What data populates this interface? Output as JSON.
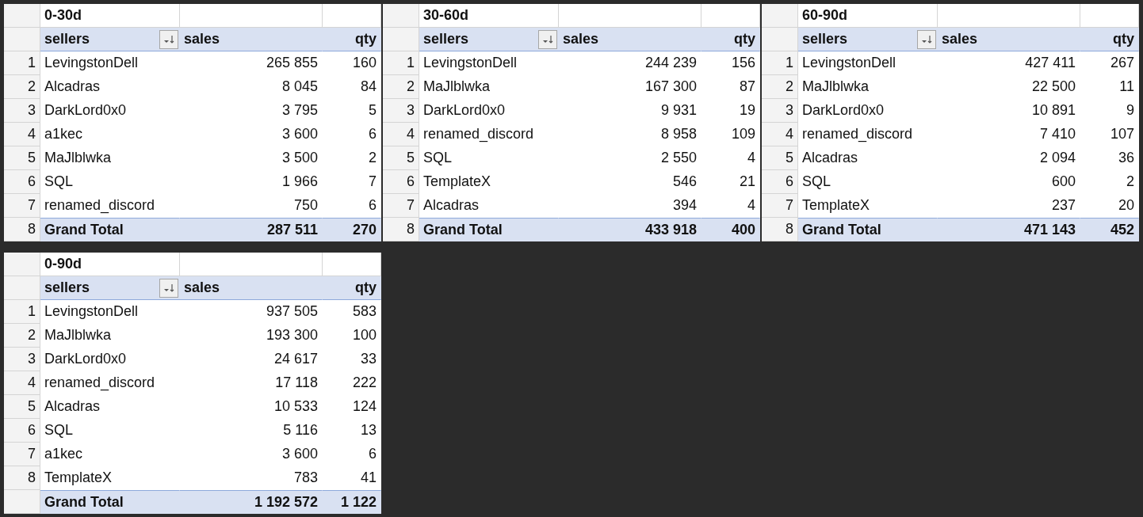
{
  "pivot_tables": [
    {
      "title": "0-30d",
      "columns": [
        "sellers",
        "sales",
        "qty"
      ],
      "rows": [
        {
          "number": "1",
          "seller": "LevingstonDell",
          "sales": "265 855",
          "qty": "160"
        },
        {
          "number": "2",
          "seller": "Alcadras",
          "sales": "8 045",
          "qty": "84"
        },
        {
          "number": "3",
          "seller": "DarkLord0x0",
          "sales": "3 795",
          "qty": "5"
        },
        {
          "number": "4",
          "seller": "a1kec",
          "sales": "3 600",
          "qty": "6"
        },
        {
          "number": "5",
          "seller": "MaJlblwka",
          "sales": "3 500",
          "qty": "2"
        },
        {
          "number": "6",
          "seller": "SQL",
          "sales": "1 966",
          "qty": "7"
        },
        {
          "number": "7",
          "seller": "renamed_discord",
          "sales": "750",
          "qty": "6"
        }
      ],
      "total": {
        "number": "8",
        "label": "Grand Total",
        "sales": "287 511",
        "qty": "270"
      }
    },
    {
      "title": "30-60d",
      "columns": [
        "sellers",
        "sales",
        "qty"
      ],
      "rows": [
        {
          "number": "1",
          "seller": "LevingstonDell",
          "sales": "244 239",
          "qty": "156"
        },
        {
          "number": "2",
          "seller": "MaJlblwka",
          "sales": "167 300",
          "qty": "87"
        },
        {
          "number": "3",
          "seller": "DarkLord0x0",
          "sales": "9 931",
          "qty": "19"
        },
        {
          "number": "4",
          "seller": "renamed_discord",
          "sales": "8 958",
          "qty": "109"
        },
        {
          "number": "5",
          "seller": "SQL",
          "sales": "2 550",
          "qty": "4"
        },
        {
          "number": "6",
          "seller": "TemplateX",
          "sales": "546",
          "qty": "21"
        },
        {
          "number": "7",
          "seller": "Alcadras",
          "sales": "394",
          "qty": "4"
        }
      ],
      "total": {
        "number": "8",
        "label": "Grand Total",
        "sales": "433 918",
        "qty": "400"
      }
    },
    {
      "title": "60-90d",
      "columns": [
        "sellers",
        "sales",
        "qty"
      ],
      "rows": [
        {
          "number": "1",
          "seller": "LevingstonDell",
          "sales": "427 411",
          "qty": "267"
        },
        {
          "number": "2",
          "seller": "MaJlblwka",
          "sales": "22 500",
          "qty": "11"
        },
        {
          "number": "3",
          "seller": "DarkLord0x0",
          "sales": "10 891",
          "qty": "9"
        },
        {
          "number": "4",
          "seller": "renamed_discord",
          "sales": "7 410",
          "qty": "107"
        },
        {
          "number": "5",
          "seller": "Alcadras",
          "sales": "2 094",
          "qty": "36"
        },
        {
          "number": "6",
          "seller": "SQL",
          "sales": "600",
          "qty": "2"
        },
        {
          "number": "7",
          "seller": "TemplateX",
          "sales": "237",
          "qty": "20"
        }
      ],
      "total": {
        "number": "8",
        "label": "Grand Total",
        "sales": "471 143",
        "qty": "452"
      }
    },
    {
      "title": "0-90d",
      "columns": [
        "sellers",
        "sales",
        "qty"
      ],
      "rows": [
        {
          "number": "1",
          "seller": "LevingstonDell",
          "sales": "937 505",
          "qty": "583"
        },
        {
          "number": "2",
          "seller": "MaJlblwka",
          "sales": "193 300",
          "qty": "100"
        },
        {
          "number": "3",
          "seller": "DarkLord0x0",
          "sales": "24 617",
          "qty": "33"
        },
        {
          "number": "4",
          "seller": "renamed_discord",
          "sales": "17 118",
          "qty": "222"
        },
        {
          "number": "5",
          "seller": "Alcadras",
          "sales": "10 533",
          "qty": "124"
        },
        {
          "number": "6",
          "seller": "SQL",
          "sales": "5 116",
          "qty": "13"
        },
        {
          "number": "7",
          "seller": "a1kec",
          "sales": "3 600",
          "qty": "6"
        },
        {
          "number": "8",
          "seller": "TemplateX",
          "sales": "783",
          "qty": "41"
        }
      ],
      "total": {
        "label": "Grand Total",
        "sales": "1 192 572",
        "qty": "1 122"
      }
    }
  ]
}
